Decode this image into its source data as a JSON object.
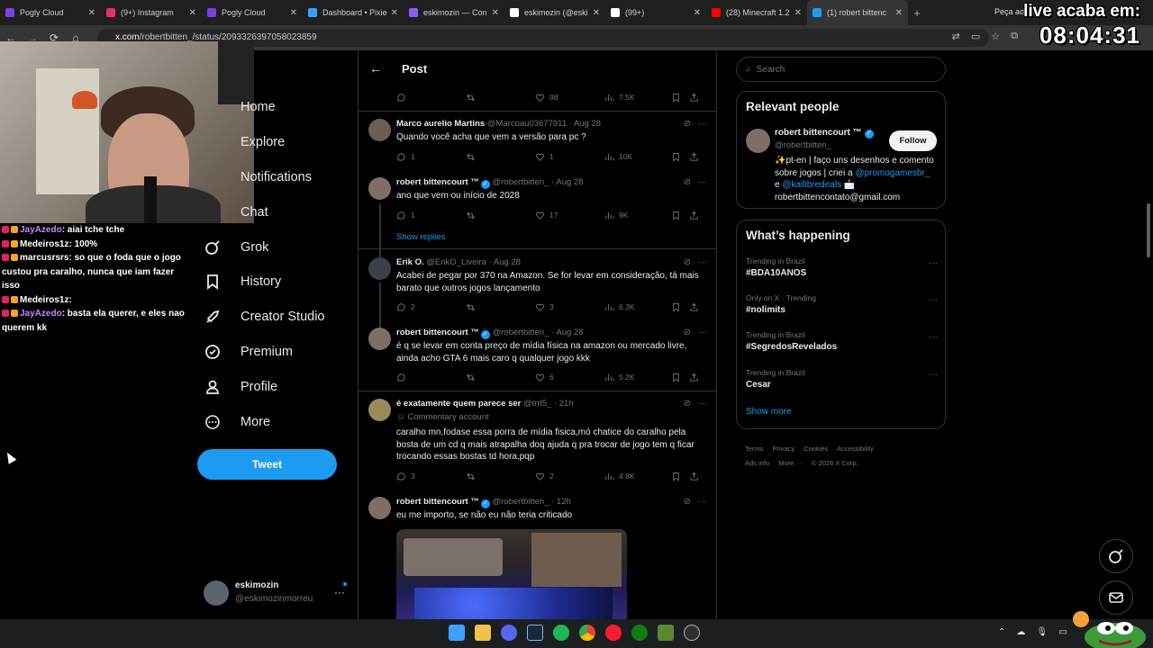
{
  "browser": {
    "tabs": [
      {
        "label": "Pogly Cloud",
        "color": "#7b3fe4"
      },
      {
        "label": "(9+) Instagram",
        "color": "#e1306c"
      },
      {
        "label": "Pogly Cloud",
        "color": "#7b3fe4"
      },
      {
        "label": "Dashboard • Pixie",
        "color": "#3aa0ff"
      },
      {
        "label": "eskimozin — Con",
        "color": "#8b5cf6"
      },
      {
        "label": "eskimozin (@eski",
        "color": "#ffffff"
      },
      {
        "label": "(99+)",
        "color": "#ffffff"
      },
      {
        "label": "(28) Minecraft 1.2",
        "color": "#ff0000"
      },
      {
        "label": "(1) robert bittenc",
        "color": "#1d9bf0"
      }
    ],
    "new_tab": "+",
    "gemini_label": "Peça ao Gemini",
    "url_host": "x.com",
    "url_path": "/robertbitten_/status/2093326397058023859"
  },
  "overlay": {
    "live_line1": "live acaba em:",
    "live_line2": "08:04:31"
  },
  "chat": [
    {
      "user": "JayAzedo",
      "user_color": "#c58af9",
      "text": "aiai tche tche"
    },
    {
      "user": "Medeiros1z",
      "user_color": "#ffffff",
      "text": "100%"
    },
    {
      "user": "marcusrsrs",
      "user_color": "#ffffff",
      "text": "so que o foda que o jogo custou pra caralho, nunca que iam fazer isso"
    },
    {
      "user": "Medeiros1z",
      "user_color": "#ffffff",
      "text": ""
    },
    {
      "user": "JayAzedo",
      "user_color": "#c58af9",
      "text": "basta ela querer, e eles nao querem kk"
    }
  ],
  "nav": {
    "items": [
      {
        "label": "Home",
        "icon": "home-icon"
      },
      {
        "label": "Explore",
        "icon": "search-icon"
      },
      {
        "label": "Notifications",
        "icon": "bell-icon"
      },
      {
        "label": "Chat",
        "icon": "mail-icon"
      },
      {
        "label": "Grok",
        "icon": "grok-icon"
      },
      {
        "label": "History",
        "icon": "bookmark-icon"
      },
      {
        "label": "Creator Studio",
        "icon": "rocket-icon"
      },
      {
        "label": "Premium",
        "icon": "verified-icon"
      },
      {
        "label": "Profile",
        "icon": "person-icon"
      },
      {
        "label": "More",
        "icon": "more-icon"
      }
    ],
    "tweet_button": "Tweet",
    "account_name": "eskimozin",
    "account_handle": "@eskimozinmorreu"
  },
  "main": {
    "header_title": "Post",
    "top_actions": {
      "reply": "",
      "retweet": "",
      "likes": "98",
      "views": "7.5K"
    },
    "replies": [
      {
        "name": "Marco aurelio Martins",
        "handle": "@Marcoau03677911",
        "time": "· Aug 28",
        "verified": false,
        "text": "Quando você acha que vem a versão para pc ?",
        "reply": "1",
        "retweet": "",
        "likes": "1",
        "views": "10K",
        "avatar_color": "#6b5e55"
      },
      {
        "name": "robert bittencourt ™",
        "handle": "@robertbitten_",
        "time": "· Aug 28",
        "verified": true,
        "text": "ano que vem ou início de 2028",
        "reply": "1",
        "retweet": "",
        "likes": "17",
        "views": "9K",
        "avatar_color": "#7d6f66"
      },
      {
        "name": "Erik O.",
        "handle": "@ErikO_Liveira",
        "time": "· Aug 28",
        "verified": false,
        "text": "Acabei de pegar por 370 na Amazon. Se for levar em consideração, tá mais barato que outros jogos lançamento",
        "reply": "2",
        "retweet": "",
        "likes": "3",
        "views": "6.3K",
        "avatar_color": "#3b3f48"
      },
      {
        "name": "robert bittencourt ™",
        "handle": "@robertbitten_",
        "time": "· Aug 28",
        "verified": true,
        "text": "é q se levar em conta preço de mídia física na amazon ou mercado livre, ainda acho GTA 6 mais caro q qualquer jogo kkk",
        "reply": "",
        "retweet": "",
        "likes": "6",
        "views": "5.2K",
        "avatar_color": "#7d6f66"
      },
      {
        "name": "é exatamente quem parece ser",
        "handle": "@trrl5_",
        "time": "· 21h",
        "verified": false,
        "sub": "Commentary account",
        "text": "caralho mn,fodase essa porra de mídia fisica,mó chatice do caralho pela bosta de um cd q mais atrapalha doq ajuda q pra trocar de jogo tem q ficar trocando essas bostas td hora,pqp",
        "reply": "3",
        "retweet": "",
        "likes": "2",
        "views": "4.8K",
        "avatar_color": "#9a8a5a"
      },
      {
        "name": "robert bittencourt ™",
        "handle": "@robertbitten_",
        "time": "· 12h",
        "verified": true,
        "text": "eu me importo, se não eu não teria criticado",
        "avatar_color": "#7d6f66"
      }
    ],
    "show_replies": "Show replies"
  },
  "right": {
    "search_placeholder": "Search",
    "relevant_title": "Relevant people",
    "person": {
      "name": "robert bittencourt ™",
      "handle": "@robertbitten_",
      "follow": "Follow",
      "bio_1": "✨pt-en | faço uns desenhos e comento sobre jogos | criei a",
      "bio_link1": "@promogamesbr_",
      "bio_mid": " e ",
      "bio_link2": "@kallibredeals",
      "bio_end": " 📩 robertbittencontato@gmail.com"
    },
    "happening_title": "What’s happening",
    "trends": [
      {
        "context": "Trending in Brazil",
        "topic": "#BDA10ANOS"
      },
      {
        "context": "Only on X · Trending",
        "topic": "#nolimits"
      },
      {
        "context": "Trending in Brazil",
        "topic": "#SegredosRevelados"
      },
      {
        "context": "Trending in Brazil",
        "topic": "Cesar"
      }
    ],
    "show_more": "Show more",
    "footer": [
      "Terms",
      "Privacy",
      "Cookies",
      "Accessibility",
      "Ads info",
      "More ···",
      "© 2026 X Corp."
    ]
  },
  "taskbar": {
    "icons": [
      "windows-icon",
      "folder-icon",
      "discord-icon",
      "steam-icon",
      "spotify-icon",
      "chrome-icon",
      "opera-icon",
      "xbox-icon",
      "minecraft-icon",
      "obs-icon"
    ]
  }
}
